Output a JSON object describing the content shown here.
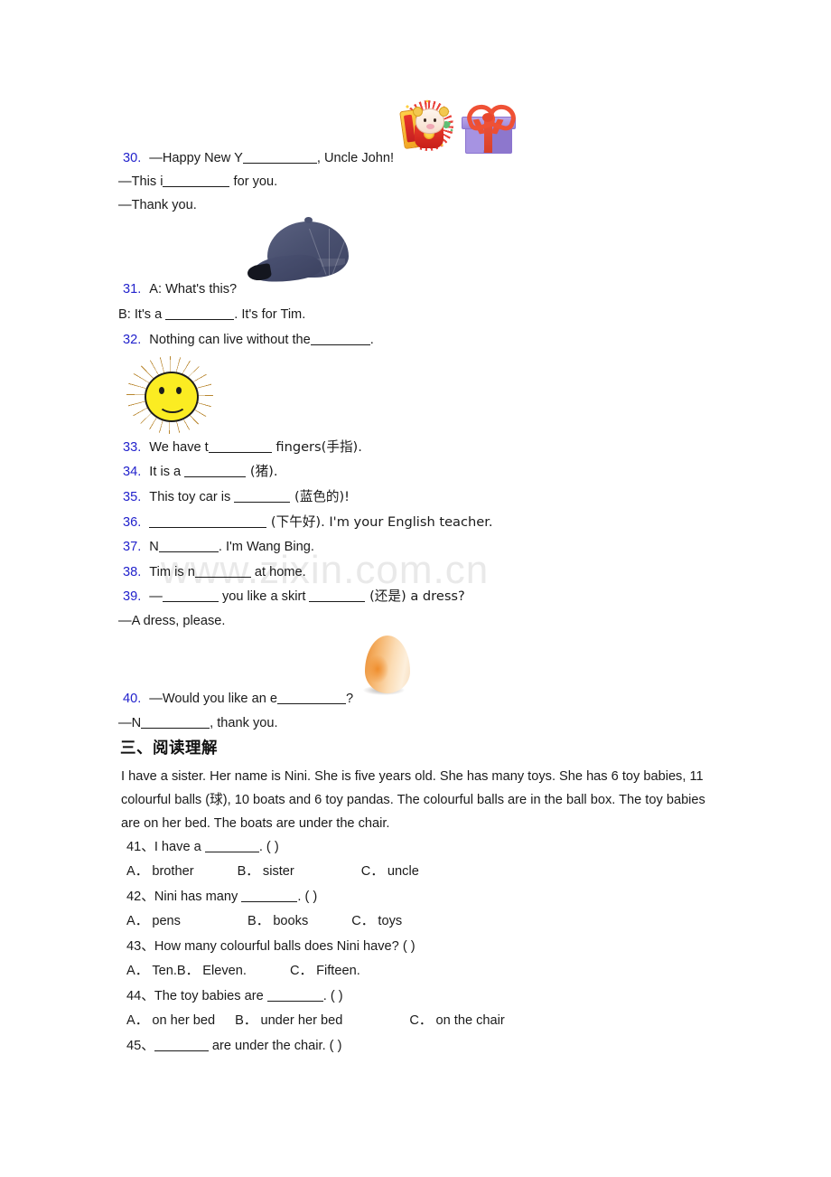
{
  "watermark": {
    "text": "www.zixin.com.cn"
  },
  "fill_in_questions": [
    {
      "number": "30.",
      "lines": [
        "—Happy New Y__________, Uncle John!",
        "—This i__________ for you.",
        "—Thank you."
      ],
      "images": [
        "chinese-new-year-ox",
        "gift-box"
      ]
    },
    {
      "number": "31.",
      "lines": [
        "A: What's this?",
        "B: It's a __________. It's for Tim."
      ],
      "images": [
        "baseball-cap"
      ]
    },
    {
      "number": "32.",
      "lines": [
        "Nothing can live without the________."
      ],
      "images": [
        "smiling-sun"
      ]
    },
    {
      "number": "33.",
      "lines": [
        "We have t________ fingers(手指)."
      ],
      "images": []
    },
    {
      "number": "34.",
      "lines": [
        "It is a ________ (猪)."
      ],
      "images": []
    },
    {
      "number": "35.",
      "lines": [
        "This toy car is _______ (蓝色的)!"
      ],
      "images": []
    },
    {
      "number": "36.",
      "lines": [
        "________________ (下午好). I'm your English teacher."
      ],
      "images": []
    },
    {
      "number": "37.",
      "lines": [
        "N________. I'm Wang Bing."
      ],
      "images": []
    },
    {
      "number": "38.",
      "lines": [
        "Tim is n_______ at home."
      ],
      "images": []
    },
    {
      "number": "39.",
      "lines": [
        "—_______ you like a skirt _______ (还是) a dress?",
        "—A dress, please."
      ],
      "images": []
    },
    {
      "number": "40.",
      "lines": [
        "—Would you like an e_________?",
        "—N_________, thank you."
      ],
      "images": [
        "egg"
      ]
    }
  ],
  "q30": {
    "number": "30.",
    "l1_a": "—Happy New Y",
    "l1_b": ", Uncle John!",
    "l2_a": "—This i",
    "l2_b": " for you.",
    "l3": "—Thank you."
  },
  "q31": {
    "number": "31.",
    "l1": "A: What's this?",
    "l2_a": "B: It's a ",
    "l2_b": ". It's for Tim."
  },
  "q32": {
    "number": "32.",
    "a": "Nothing can live without the",
    "b": "."
  },
  "q33": {
    "number": "33.",
    "a": "We have t",
    "b": " fingers(手指)."
  },
  "q34": {
    "number": "34.",
    "a": "It is a ",
    "b": " (猪)."
  },
  "q35": {
    "number": "35.",
    "a": "This toy car is ",
    "b": " (蓝色的)!"
  },
  "q36": {
    "number": "36.",
    "a": "",
    "b": " (下午好). I'm your English teacher."
  },
  "q37": {
    "number": "37.",
    "a": "N",
    "b": ". I'm Wang Bing."
  },
  "q38": {
    "number": "38.",
    "a": "Tim is n",
    "b": " at home."
  },
  "q39": {
    "number": "39.",
    "a": "—",
    "b": " you like a skirt ",
    "c": " (还是) a dress?",
    "l2": "—A dress, please."
  },
  "q40": {
    "number": "40.",
    "a": "—Would you like an e",
    "b": "?",
    "l2_a": "—N",
    "l2_b": ", thank you."
  },
  "reading": {
    "heading": "三、阅读理解",
    "passage": "I have a sister. Her name is Nini. She is five years old. She has many toys. She has 6 toy babies, 11 colourful balls (球), 10 boats and 6 toy pandas. The colourful balls are in the ball box. The toy babies are on her bed. The boats are under the chair.",
    "questions": [
      {
        "number": "41、",
        "stem_a": "I have a ",
        "stem_b": ". (    )",
        "options": [
          {
            "label": "A．",
            "text": "brother"
          },
          {
            "label": "B．",
            "text": "sister"
          },
          {
            "label": "C．",
            "text": "uncle"
          }
        ]
      },
      {
        "number": "42、",
        "stem_a": "Nini has many ",
        "stem_b": ". (    )",
        "options": [
          {
            "label": "A．",
            "text": "pens"
          },
          {
            "label": "B．",
            "text": "books"
          },
          {
            "label": "C．",
            "text": "toys"
          }
        ]
      },
      {
        "number": "43、",
        "stem_a": "How many colourful balls does Nini have? (    )",
        "stem_b": "",
        "options": [
          {
            "label": "A．",
            "text": "Ten."
          },
          {
            "label": "B．",
            "text": "Eleven."
          },
          {
            "label": "C．",
            "text": "Fifteen."
          }
        ]
      },
      {
        "number": "44、",
        "stem_a": "The toy babies are ",
        "stem_b": ". (    )",
        "options": [
          {
            "label": "A．",
            "text": "on her bed"
          },
          {
            "label": "B．",
            "text": "under her bed"
          },
          {
            "label": "C．",
            "text": "on the chair"
          }
        ]
      },
      {
        "number": "45、",
        "stem_a": "",
        "stem_b": " are under the chair. (    )",
        "options": []
      }
    ]
  },
  "q41": {
    "number": "41、",
    "a": "I have a ",
    "b": ". (    )"
  },
  "q41o": {
    "A": "A．",
    "A_t": "brother",
    "B": "B．",
    "B_t": "sister",
    "C": "C．",
    "C_t": "uncle"
  },
  "q42": {
    "number": "42、",
    "a": "Nini has many ",
    "b": ". (    )"
  },
  "q42o": {
    "A": "A．",
    "A_t": "pens",
    "B": "B．",
    "B_t": "books",
    "C": "C．",
    "C_t": "toys"
  },
  "q43": {
    "number": "43、",
    "a": "How many colourful balls does Nini have? (    )"
  },
  "q43o": {
    "A": "A．",
    "A_t": "Ten.",
    "B": "B．",
    "B_t": "Eleven.",
    "C": "C．",
    "C_t": "Fifteen."
  },
  "q44": {
    "number": "44、",
    "a": "The toy babies are ",
    "b": ". (    )"
  },
  "q44o": {
    "A": "A．",
    "A_t": "on her bed",
    "B": "B．",
    "B_t": "under her bed",
    "C": "C．",
    "C_t": "on the chair"
  },
  "q45": {
    "number": "45、",
    "a": "",
    "b": " are under the chair. (    )"
  },
  "colors": {
    "question_number": "#2222cc",
    "body_text": "#1a1a1a",
    "watermark": "#e9e9e9",
    "cap_navy": "#4a5170",
    "gift_purple": "#a693e2",
    "ribbon_red": "#ef5135",
    "sun_yellow": "#fbec22",
    "egg_orange": "#ef8d2c"
  }
}
